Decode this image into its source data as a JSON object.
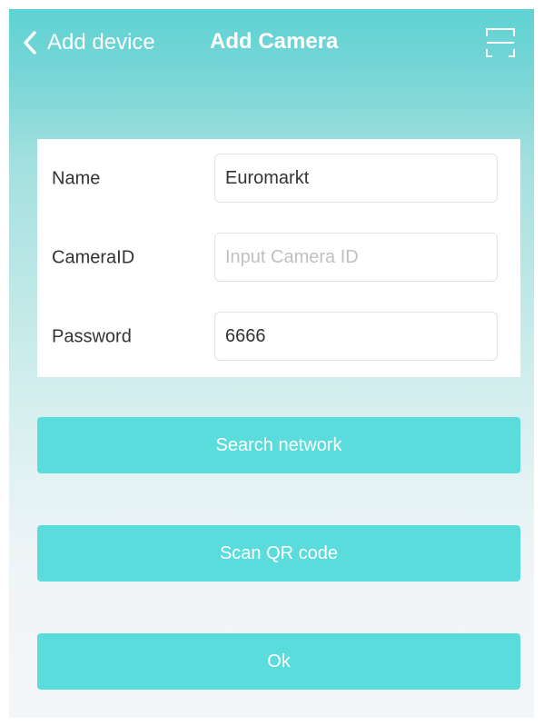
{
  "header": {
    "back_label": "Add device",
    "title": "Add Camera",
    "scan_icon": "scan-frame-icon"
  },
  "form": {
    "name": {
      "label": "Name",
      "value": "Euromarkt"
    },
    "camera_id": {
      "label": "CameraID",
      "value": "",
      "placeholder": "Input Camera ID"
    },
    "password": {
      "label": "Password",
      "value": "6666"
    }
  },
  "buttons": {
    "search_network": "Search network",
    "scan_qr": "Scan QR code",
    "ok": "Ok"
  },
  "colors": {
    "accent": "#5adcdc",
    "header_top": "#5fd2d4",
    "background_bottom": "#f3f6f9",
    "text": "#333333",
    "placeholder": "#c0c0c0"
  }
}
